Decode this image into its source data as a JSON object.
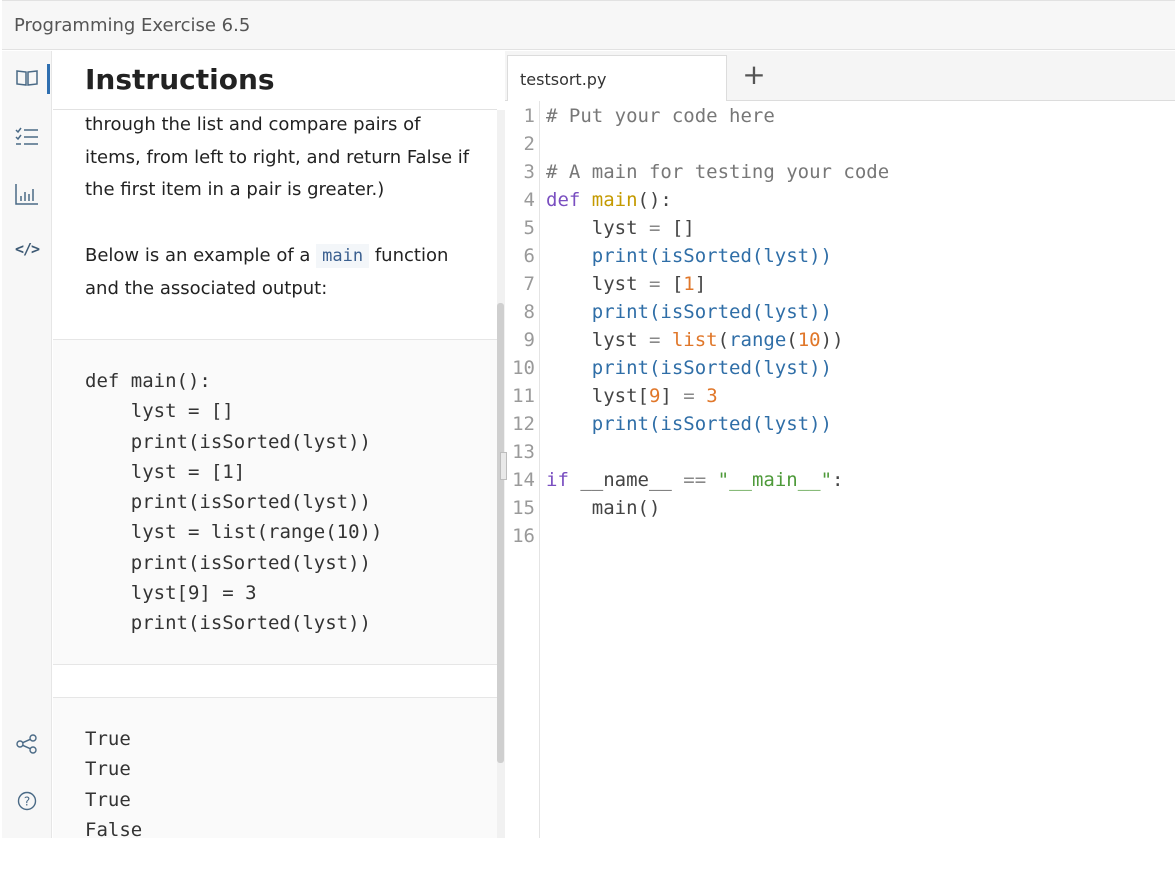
{
  "window": {
    "title": "Programming Exercise 6.5"
  },
  "rail": {
    "icons": [
      "book-icon",
      "checklist-icon",
      "bar-chart-icon",
      "code-icon",
      "share-icon",
      "help-icon"
    ],
    "code_glyph": "</>",
    "help_glyph": "?"
  },
  "instructions": {
    "heading": "Instructions",
    "para1_lines": [
      "through the list and compare pairs of",
      "items, from left to right, and return False if",
      "the first item in a pair is greater.)"
    ],
    "para2_before": "Below is an example of a ",
    "para2_code": "main",
    "para2_after": " function",
    "para2_line2": "and the associated output:",
    "example_code": "def main():\n    lyst = []\n    print(isSorted(lyst))\n    lyst = [1]\n    print(isSorted(lyst))\n    lyst = list(range(10))\n    print(isSorted(lyst))\n    lyst[9] = 3\n    print(isSorted(lyst))",
    "example_output": "True\nTrue\nTrue\nFalse"
  },
  "editor": {
    "tab_label": "testsort.py",
    "add_tab": "+",
    "line_numbers": [
      "1",
      "2",
      "3",
      "4",
      "5",
      "6",
      "7",
      "8",
      "9",
      "10",
      "11",
      "12",
      "13",
      "14",
      "15",
      "16"
    ]
  },
  "colors": {
    "keyword": "#7a4fc0",
    "function_name": "#c49a00",
    "builtin_call": "#2f6ea7",
    "number": "#e0772a",
    "string": "#4e9a3a",
    "comment": "#777777"
  }
}
